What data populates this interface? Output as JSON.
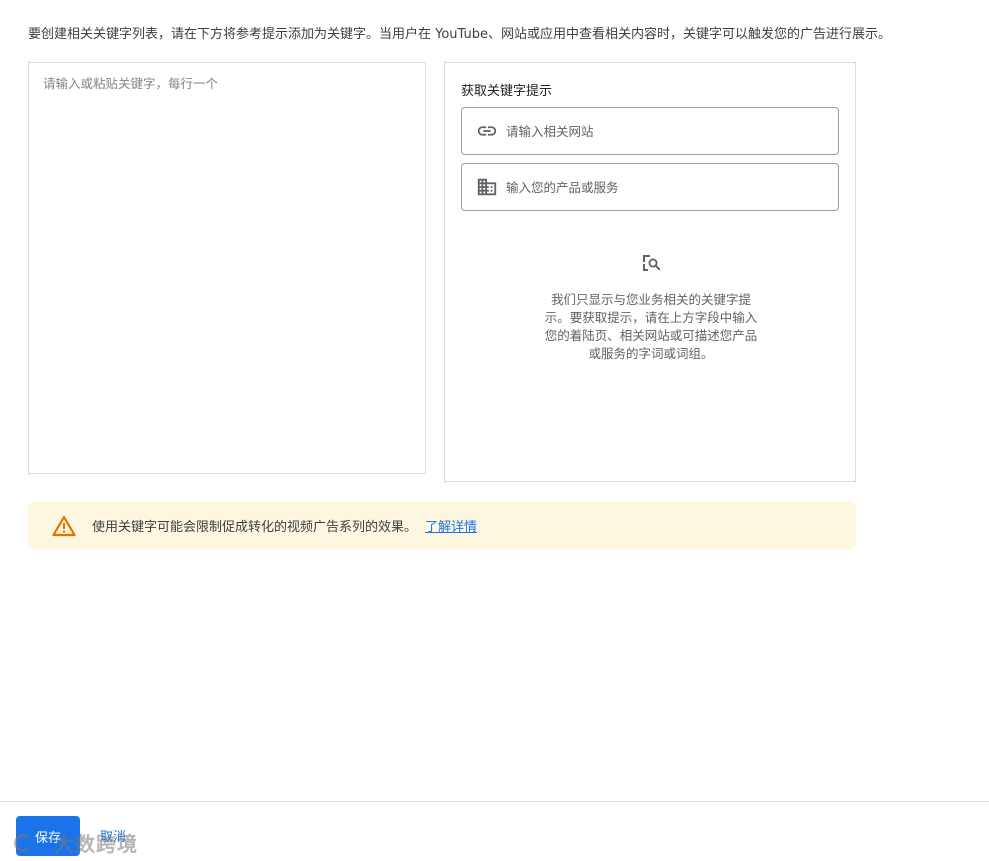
{
  "intro_text": "要创建相关关键字列表，请在下方将参考提示添加为关键字。当用户在 YouTube、网站或应用中查看相关内容时，关键字可以触发您的广告进行展示。",
  "keyword_input": {
    "value": "",
    "placeholder": "请输入或粘贴关键字，每行一个"
  },
  "suggestions": {
    "title": "获取关键字提示",
    "website_field": {
      "icon": "link-icon",
      "value": "",
      "placeholder": "请输入相关网站"
    },
    "product_field": {
      "icon": "business-icon",
      "value": "",
      "placeholder": "输入您的产品或服务"
    },
    "empty_state": {
      "icon": "image-search-icon",
      "text": "我们只显示与您业务相关的关键字提示。要获取提示，请在上方字段中输入您的着陆页、相关网站或可描述您产品或服务的字词或词组。"
    }
  },
  "warning": {
    "icon": "warning-icon",
    "text": "使用关键字可能会限制促成转化的视频广告系列的效果。",
    "link_label": "了解详情"
  },
  "footer": {
    "save_label": "保存",
    "cancel_label": "取消"
  },
  "watermark": {
    "text": "大数跨境"
  },
  "colors": {
    "accent": "#1a73e8",
    "warning_bg": "#fef7e0",
    "warning_icon": "#e37400",
    "border": "#dadce0",
    "text": "#3c4043"
  }
}
